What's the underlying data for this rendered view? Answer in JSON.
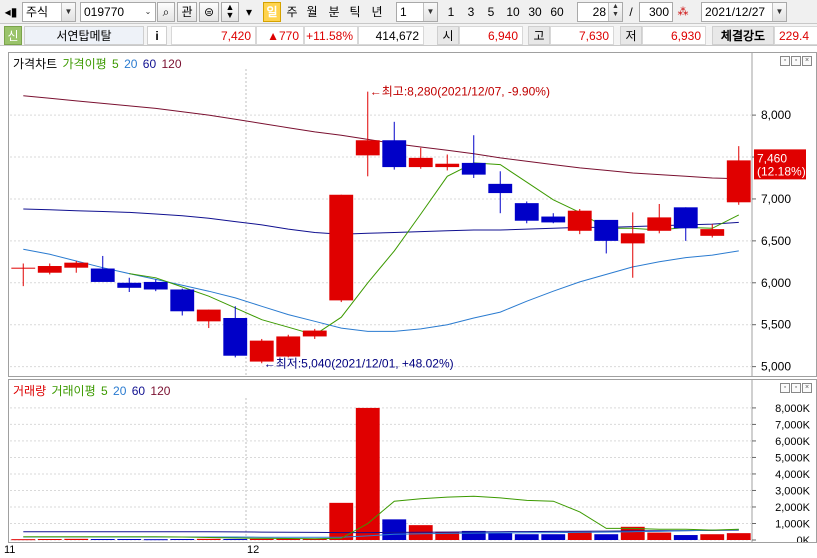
{
  "toolbar": {
    "market": "주식",
    "code": "019770",
    "search_btn": "⌕",
    "watch_btn": "관",
    "day_btn": "일",
    "week_btn": "주",
    "month_btn": "월",
    "minute_btn": "분",
    "tick_btn": "틱",
    "year_btn": "년",
    "period_value": "1",
    "quick_periods": [
      "1",
      "3",
      "5",
      "10",
      "30",
      "60"
    ],
    "view_count": "28",
    "total_count": "300",
    "date": "2021/12/27",
    "slash": "/"
  },
  "quote": {
    "credit": "신",
    "name": "서연탑메탈",
    "info_btn": "i",
    "price": "7,420",
    "change": "▲770",
    "change_pct": "+11.58%",
    "volume": "414,672",
    "open_label": "시",
    "open": "6,940",
    "high_label": "고",
    "high": "7,630",
    "low_label": "저",
    "low": "6,930",
    "strength_label": "체결강도",
    "strength": "229.4"
  },
  "price_panel": {
    "legend_title": "가격차트",
    "legend_ma": "가격이평",
    "ma_periods": [
      "5",
      "20",
      "60",
      "120"
    ],
    "high_annotation": "←최고:8,280(2021/12/07, -9.90%)",
    "low_annotation": "←최저:5,040(2021/12/01, +48.02%)",
    "current_price_label": "7,460",
    "current_pct_label": "(12.18%)",
    "y_ticks": [
      "8,000",
      "7,500",
      "7,000",
      "6,500",
      "6,000",
      "5,500",
      "5,000"
    ]
  },
  "volume_panel": {
    "legend_title": "거래량",
    "legend_ma": "거래이평",
    "ma_periods": [
      "5",
      "20",
      "60",
      "120"
    ],
    "y_ticks": [
      "8,000K",
      "7,000K",
      "6,000K",
      "5,000K",
      "4,000K",
      "3,000K",
      "2,000K",
      "1,000K",
      "0K"
    ]
  },
  "x_axis": {
    "labels": [
      "11",
      "12"
    ]
  },
  "colors": {
    "up": "#e00000",
    "down": "#0000c8",
    "ma5": "#3c9a00",
    "ma20": "#2a7bd0",
    "ma60": "#101090",
    "ma120": "#7a1030"
  },
  "chart_data": {
    "type": "candlestick",
    "price_unit": "KRW",
    "candles": [
      {
        "o": 6180,
        "h": 6230,
        "l": 5960,
        "c": 6180
      },
      {
        "o": 6120,
        "h": 6230,
        "l": 6100,
        "c": 6200
      },
      {
        "o": 6180,
        "h": 6260,
        "l": 6120,
        "c": 6240
      },
      {
        "o": 6170,
        "h": 6320,
        "l": 6030,
        "c": 6010
      },
      {
        "o": 6000,
        "h": 6060,
        "l": 5890,
        "c": 5940
      },
      {
        "o": 6010,
        "h": 6040,
        "l": 5900,
        "c": 5920
      },
      {
        "o": 5920,
        "h": 5930,
        "l": 5610,
        "c": 5660
      },
      {
        "o": 5540,
        "h": 5680,
        "l": 5460,
        "c": 5680
      },
      {
        "o": 5580,
        "h": 5720,
        "l": 5110,
        "c": 5130
      },
      {
        "o": 5060,
        "h": 5330,
        "l": 5040,
        "c": 5310
      },
      {
        "o": 5120,
        "h": 5380,
        "l": 5110,
        "c": 5360
      },
      {
        "o": 5360,
        "h": 5450,
        "l": 5330,
        "c": 5430
      },
      {
        "o": 5790,
        "h": 7050,
        "l": 5770,
        "c": 7050
      },
      {
        "o": 7520,
        "h": 8280,
        "l": 7270,
        "c": 7700
      },
      {
        "o": 7700,
        "h": 7920,
        "l": 7350,
        "c": 7380
      },
      {
        "o": 7380,
        "h": 7610,
        "l": 7360,
        "c": 7490
      },
      {
        "o": 7380,
        "h": 7530,
        "l": 7340,
        "c": 7420
      },
      {
        "o": 7430,
        "h": 7760,
        "l": 7250,
        "c": 7290
      },
      {
        "o": 7180,
        "h": 7330,
        "l": 6830,
        "c": 7070
      },
      {
        "o": 6950,
        "h": 6970,
        "l": 6710,
        "c": 6740
      },
      {
        "o": 6790,
        "h": 6830,
        "l": 6710,
        "c": 6720
      },
      {
        "o": 6620,
        "h": 6880,
        "l": 6580,
        "c": 6860
      },
      {
        "o": 6750,
        "h": 6740,
        "l": 6350,
        "c": 6500
      },
      {
        "o": 6470,
        "h": 6840,
        "l": 6060,
        "c": 6590
      },
      {
        "o": 6620,
        "h": 6940,
        "l": 6590,
        "c": 6780
      },
      {
        "o": 6900,
        "h": 6900,
        "l": 6500,
        "c": 6650
      },
      {
        "o": 6560,
        "h": 6700,
        "l": 6540,
        "c": 6640
      },
      {
        "o": 6960,
        "h": 7630,
        "l": 6930,
        "c": 7460
      }
    ],
    "volume_k": [
      50,
      60,
      70,
      60,
      60,
      50,
      60,
      70,
      60,
      70,
      80,
      90,
      2250,
      8000,
      1250,
      900,
      500,
      550,
      450,
      350,
      350,
      500,
      350,
      800,
      450,
      300,
      350,
      414.672
    ],
    "ma5": [
      null,
      null,
      null,
      null,
      6110,
      6060,
      5950,
      5840,
      5700,
      5560,
      5470,
      5380,
      5590,
      6000,
      6380,
      6820,
      7270,
      7430,
      7410,
      7200,
      6990,
      6840,
      6650,
      6650,
      6630,
      6660,
      6650,
      6810
    ],
    "ma20": [
      6400,
      6340,
      6260,
      6180,
      6110,
      6040,
      5970,
      5900,
      5820,
      5720,
      5620,
      5540,
      5460,
      5420,
      5420,
      5450,
      5500,
      5580,
      5650,
      5780,
      5900,
      6010,
      6100,
      6190,
      6250,
      6300,
      6330,
      6380
    ],
    "ma60": [
      6880,
      6870,
      6860,
      6850,
      6840,
      6820,
      6800,
      6770,
      6730,
      6690,
      6640,
      6600,
      6580,
      6590,
      6600,
      6610,
      6620,
      6630,
      6630,
      6640,
      6650,
      6660,
      6660,
      6670,
      6680,
      6690,
      6700,
      6720
    ],
    "ma120": [
      8230,
      8200,
      8170,
      8140,
      8110,
      8080,
      8040,
      8000,
      7950,
      7900,
      7850,
      7800,
      7760,
      7710,
      7660,
      7620,
      7580,
      7540,
      7490,
      7450,
      7410,
      7370,
      7340,
      7310,
      7290,
      7270,
      7250,
      7240
    ],
    "vol_ma5": [
      200,
      200,
      200,
      200,
      200,
      200,
      180,
      150,
      120,
      100,
      90,
      80,
      100,
      1000,
      2350,
      2500,
      2600,
      2650,
      2550,
      2400,
      2350,
      1700,
      700,
      700,
      650,
      650,
      600,
      650
    ],
    "vol_ma20": [
      180,
      180,
      180,
      180,
      180,
      180,
      180,
      180,
      180,
      170,
      170,
      170,
      170,
      250,
      350,
      380,
      400,
      420,
      430,
      440,
      450,
      460,
      480,
      500,
      520,
      560,
      600,
      620
    ],
    "vol_ma60": [
      500,
      500,
      500,
      500,
      500,
      500,
      500,
      500,
      490,
      480,
      470,
      460,
      450,
      450,
      460,
      470,
      480,
      490,
      500,
      510,
      520,
      530,
      540,
      550,
      560,
      570,
      580,
      600
    ],
    "ylim_price": [
      4900,
      8550
    ],
    "ylim_volume_k": [
      0,
      8600
    ]
  }
}
